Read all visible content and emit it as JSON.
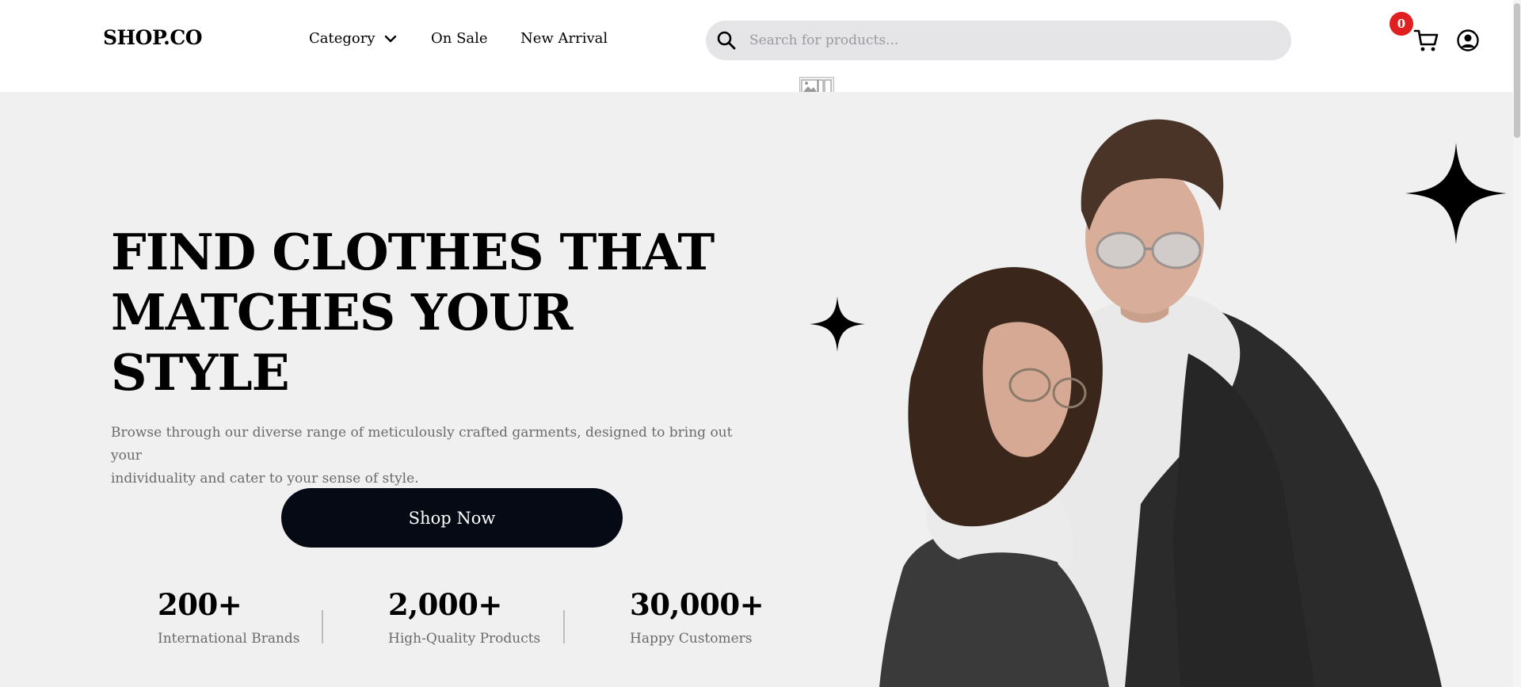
{
  "header": {
    "logo": "SHOP.CO",
    "nav": {
      "category": "Category",
      "on_sale": "On Sale",
      "new_arrival": "New Arrival"
    },
    "search": {
      "placeholder": "Search for products..."
    },
    "cart": {
      "count": "0"
    },
    "icons": [
      "chevron-down-icon",
      "search-icon",
      "cart-icon",
      "account-icon",
      "broken-image-icon"
    ]
  },
  "hero": {
    "headline": [
      "FIND CLOTHES THAT",
      "MATCHES YOUR",
      "STYLE"
    ],
    "description_lines": [
      "Browse through our diverse range of meticulously crafted garments, designed to bring out your",
      "individuality and cater to your sense of style."
    ],
    "cta": "Shop Now",
    "stats": [
      {
        "value": "200+",
        "label": "International Brands"
      },
      {
        "value": "2,000+",
        "label": "High-Quality Products"
      },
      {
        "value": "30,000+",
        "label": "Happy Customers"
      }
    ],
    "decorations": [
      "sparkle-icon",
      "sparkle-icon"
    ]
  },
  "colors": {
    "hero_bg": "#f1f0f0",
    "button_bg": "#050a14",
    "badge": "#e02020",
    "search_bg": "#e5e5e8"
  }
}
